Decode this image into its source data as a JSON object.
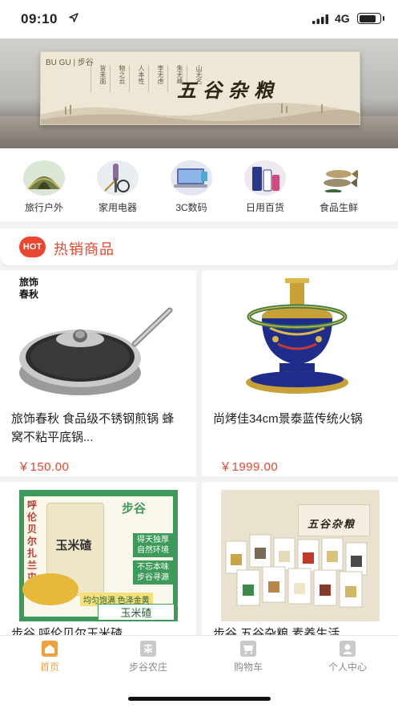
{
  "status": {
    "time": "09:10",
    "network": "4G",
    "battery_level": 0.8
  },
  "banner": {
    "logo": "BU GU | 步谷",
    "box_columns": [
      "皆未面",
      "物之云",
      "人本性",
      "李无虑",
      "朱无峰",
      "山无名"
    ],
    "box_title": "五谷杂粮"
  },
  "categories": [
    {
      "label": "旅行户外",
      "icon": "tent-icon"
    },
    {
      "label": "家用电器",
      "icon": "hair-dryer-icon"
    },
    {
      "label": "3C数码",
      "icon": "laptop-icon"
    },
    {
      "label": "日用百货",
      "icon": "toiletries-icon"
    },
    {
      "label": "食品生鲜",
      "icon": "fish-icon"
    }
  ],
  "hot_section": {
    "badge": "HOT",
    "title": "热销商品"
  },
  "products": [
    {
      "name": "旅饰春秋 食品级不锈钢煎锅 蜂窝不粘平底锅...",
      "price": "￥150.00",
      "image": "frying-pan-image",
      "brand_mark": "旅饰春秋"
    },
    {
      "name": "尚烤佳34cm景泰蓝传统火锅",
      "price": "￥1999.00",
      "image": "cloisonne-hotpot-image"
    },
    {
      "name": "步谷 呼伦贝尔玉米碴",
      "price": "",
      "image": "corn-grits-bag-image",
      "packaging": {
        "brand": "步谷",
        "side_text": "呼伦贝尔扎兰屯",
        "product": "玉米碴",
        "tag1": "得天独厚 自然环境",
        "tag2": "不忘本味 步谷寻源",
        "footer": "均匀饱满 色泽金黄"
      }
    },
    {
      "name": "步谷 五谷杂粮 素养生活",
      "price": "",
      "image": "grain-gift-box-image",
      "box_title": "五谷杂粮"
    }
  ],
  "tabs": [
    {
      "label": "首页",
      "icon": "home-icon",
      "active": true
    },
    {
      "label": "步谷农庄",
      "icon": "farm-icon",
      "active": false
    },
    {
      "label": "购物车",
      "icon": "cart-icon",
      "active": false
    },
    {
      "label": "个人中心",
      "icon": "user-icon",
      "active": false
    }
  ]
}
